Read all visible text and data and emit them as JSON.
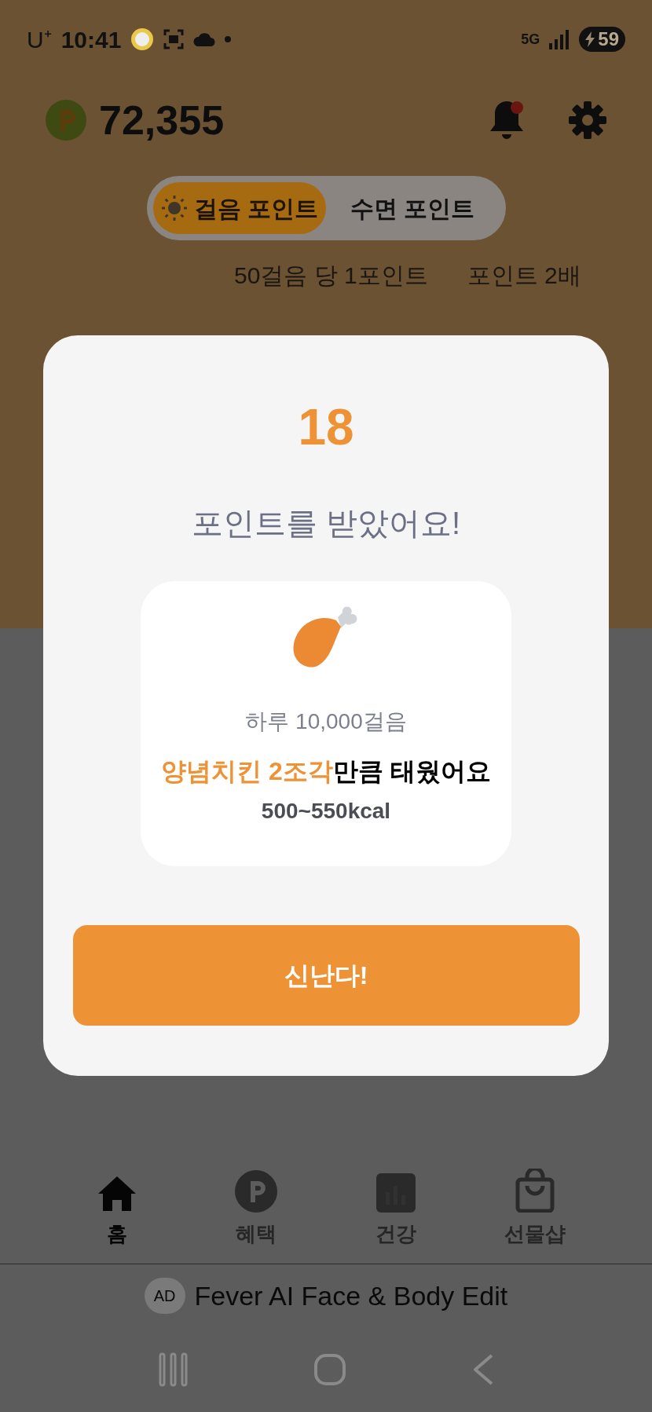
{
  "status_bar": {
    "carrier": "U⁺",
    "time": "10:41",
    "network": "5G",
    "battery": "59"
  },
  "header": {
    "points": "72,355"
  },
  "mode_tabs": [
    {
      "label": "걸음 포인트",
      "selected": true
    },
    {
      "label": "수면 포인트",
      "selected": false
    }
  ],
  "info": [
    "50걸음 당 1포인트",
    "포인트 2배"
  ],
  "dialog": {
    "amount": "18",
    "title": "포인트를 받았어요!",
    "steps": "하루 10,000걸음",
    "burn_highlight": "양념치킨 2조각",
    "burn_rest": "만큼 태웠어요",
    "kcal": "500~550kcal",
    "button": "신난다!"
  },
  "bottom_tabs": [
    {
      "label": "홈",
      "kind": "home",
      "selected": true
    },
    {
      "label": "혜택",
      "kind": "points",
      "selected": false
    },
    {
      "label": "건강",
      "kind": "chart",
      "selected": false
    },
    {
      "label": "선물샵",
      "kind": "shop",
      "selected": false
    }
  ],
  "ad": {
    "badge": "AD",
    "text": "Fever AI Face & Body Edit"
  }
}
